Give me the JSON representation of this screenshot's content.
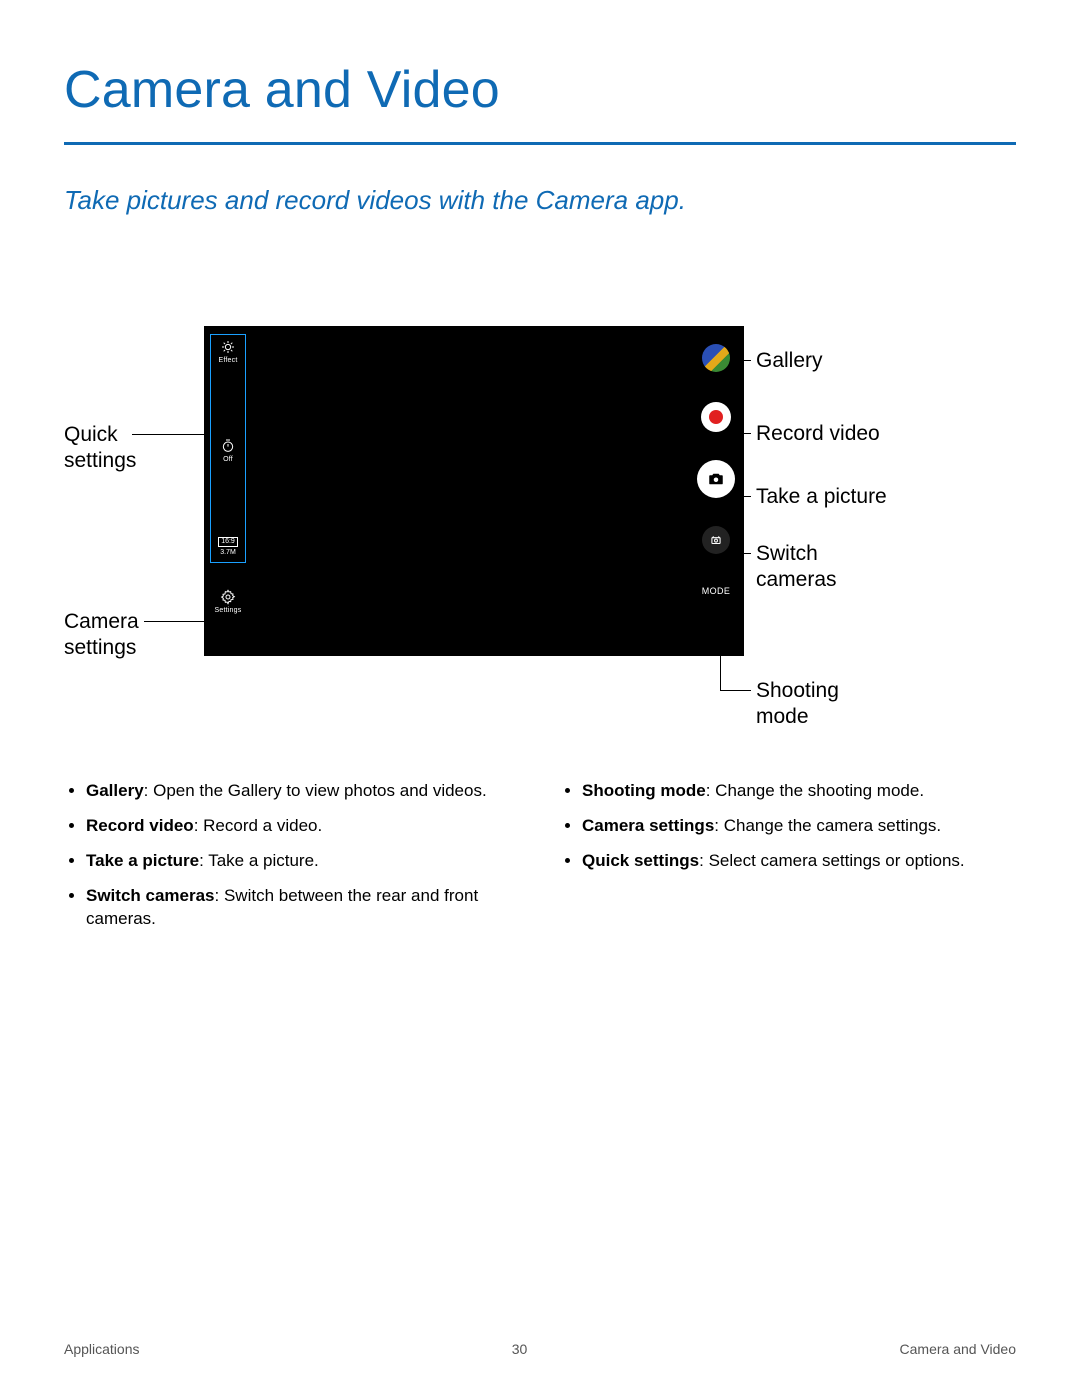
{
  "title": "Camera and Video",
  "subtitle": "Take pictures and record videos with the Camera app.",
  "camera_ui": {
    "left": {
      "effect_label": "Effect",
      "timer_label": "Off",
      "ratio": "16:9",
      "megapixels": "3.7M",
      "settings_label": "Settings"
    },
    "right": {
      "mode_label": "MODE"
    }
  },
  "callouts": {
    "quick_settings": "Quick\nsettings",
    "camera_settings": "Camera\nsettings",
    "gallery": "Gallery",
    "record_video": "Record video",
    "take_picture": "Take a picture",
    "switch_cameras": "Switch\ncameras",
    "shooting_mode": "Shooting\nmode"
  },
  "bullets_left": [
    {
      "term": "Gallery",
      "desc": ": Open the Gallery to view photos and videos."
    },
    {
      "term": "Record video",
      "desc": ": Record a video."
    },
    {
      "term": "Take a picture",
      "desc": ": Take a picture."
    },
    {
      "term": "Switch cameras",
      "desc": ": Switch between the rear and front cameras."
    }
  ],
  "bullets_right": [
    {
      "term": "Shooting mode",
      "desc": ": Change the shooting mode."
    },
    {
      "term": "Camera settings",
      "desc": ": Change the camera settings."
    },
    {
      "term": "Quick settings",
      "desc": ": Select camera settings or options."
    }
  ],
  "footer": {
    "left": "Applications",
    "center": "30",
    "right": "Camera and Video"
  }
}
